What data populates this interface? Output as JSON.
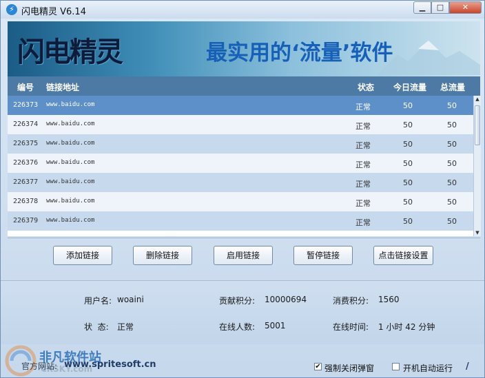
{
  "window": {
    "title": "闪电精灵 V6.14"
  },
  "banner": {
    "logo": "闪电精灵",
    "slogan": "最实用的‘流量’软件"
  },
  "table": {
    "headers": {
      "id": "编号",
      "url": "链接地址",
      "status": "状态",
      "today": "今日流量",
      "total": "总流量"
    },
    "rows": [
      {
        "id": "226373",
        "url": "www.baidu.com",
        "status": "正常",
        "today": "50",
        "total": "50",
        "selected": true
      },
      {
        "id": "226374",
        "url": "www.baidu.com",
        "status": "正常",
        "today": "50",
        "total": "50"
      },
      {
        "id": "226375",
        "url": "www.baidu.com",
        "status": "正常",
        "today": "50",
        "total": "50"
      },
      {
        "id": "226376",
        "url": "www.baidu.com",
        "status": "正常",
        "today": "50",
        "total": "50"
      },
      {
        "id": "226377",
        "url": "www.baidu.com",
        "status": "正常",
        "today": "50",
        "total": "50"
      },
      {
        "id": "226378",
        "url": "www.baidu.com",
        "status": "正常",
        "today": "50",
        "total": "50"
      },
      {
        "id": "226379",
        "url": "www.baidu.com",
        "status": "正常",
        "today": "50",
        "total": "50"
      }
    ]
  },
  "buttons": {
    "add": "添加链接",
    "delete": "删除链接",
    "enable": "启用链接",
    "pause": "暂停链接",
    "settings": "点击链接设置"
  },
  "info": {
    "username_label": "用户名:",
    "username": "woaini",
    "contrib_label": "贡献积分:",
    "contrib": "10000694",
    "consume_label": "消费积分:",
    "consume": "1560",
    "status_label": "状  态:",
    "status": "正常",
    "online_label": "在线人数:",
    "online": "5001",
    "time_label": "在线时间:",
    "time": "1 小时 42 分钟"
  },
  "footer": {
    "site_label": "官方网站:",
    "site_url": "www.spritesoft.cn",
    "watermark": "非凡软件站",
    "watermark_sub": "CRSKY.com",
    "force_close_label": "强制关闭弹窗",
    "force_close_checked": true,
    "autostart_label": "开机自动运行",
    "autostart_checked": false
  }
}
